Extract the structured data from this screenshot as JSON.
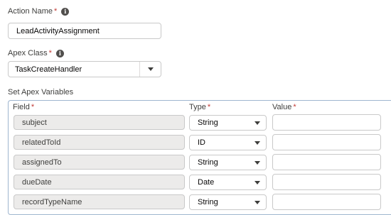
{
  "action_name": {
    "label": "Action Name",
    "required_mark": "*",
    "value": "LeadActivityAssignment"
  },
  "apex_class": {
    "label": "Apex Class",
    "required_mark": "*",
    "value": "TaskCreateHandler"
  },
  "apex_variables": {
    "section_label": "Set Apex Variables",
    "columns": {
      "field": "Field",
      "type": "Type",
      "value": "Value",
      "required_mark": "*"
    },
    "rows": [
      {
        "field": "subject",
        "type": "String",
        "value": ""
      },
      {
        "field": "relatedToId",
        "type": "ID",
        "value": ""
      },
      {
        "field": "assignedTo",
        "type": "String",
        "value": ""
      },
      {
        "field": "dueDate",
        "type": "Date",
        "value": ""
      },
      {
        "field": "recordTypeName",
        "type": "String",
        "value": ""
      }
    ]
  },
  "icons": {
    "info": "info-icon",
    "dropdown": "chevron-down-icon"
  },
  "colors": {
    "required": "#c23934",
    "panel_border": "#9fb6cf",
    "readonly_bg": "#ecebea"
  }
}
